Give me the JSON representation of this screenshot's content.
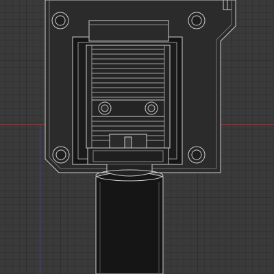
{
  "viewport": {
    "background": "#3a3a3a",
    "grid_color": "#2f2f2f",
    "x_axis_color": "#aa3c3c",
    "y_axis_color": "#505ac8"
  },
  "model": {
    "outline_color": "#cfcfcf",
    "fill_color": "#2b2b2b",
    "icons": [
      "bracket-plate",
      "mounting-hole",
      "heatsink",
      "fan-screw",
      "nozzle-cylinder"
    ]
  }
}
